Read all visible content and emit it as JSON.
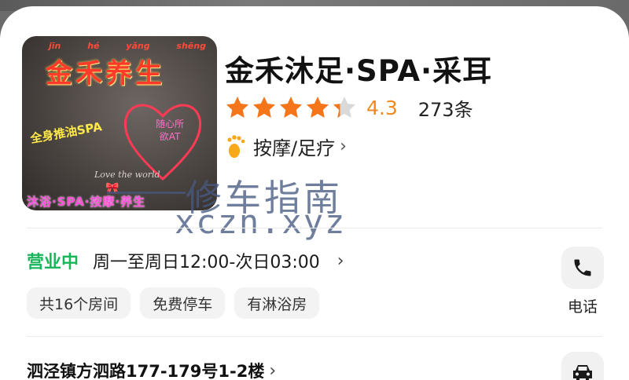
{
  "thumbnail": {
    "pinyin": [
      "jīn",
      "hé",
      "yǎng",
      "shēng"
    ],
    "brand": "金禾养生",
    "tagline": "全身推油SPA",
    "heart_text": [
      "随心所",
      "欲AT"
    ],
    "script": "Love the world",
    "bottom_tag": "沐浴·SPA·按摩·养生"
  },
  "shop": {
    "title": "金禾沐足·SPA·采耳",
    "rating": {
      "value": 4.3,
      "score_text": "4.3",
      "count_text": "273条",
      "star_color": "#f5761a",
      "empty_star_color": "#d9d9d9"
    },
    "category": "按摩/足疗",
    "category_icon": "footprint-icon"
  },
  "watermark": {
    "line1": "修车指南",
    "line2": "xczn.xyz"
  },
  "hours": {
    "status": "营业中",
    "status_color": "#18b55a",
    "text": "周一至周日12:00-次日03:00"
  },
  "chips": [
    "共16个房间",
    "免费停车",
    "有淋浴房"
  ],
  "actions": {
    "phone_label": "电话",
    "phone_icon": "phone-icon",
    "car_icon": "car-icon"
  },
  "address": "泗泾镇方泗路177-179号1-2楼"
}
